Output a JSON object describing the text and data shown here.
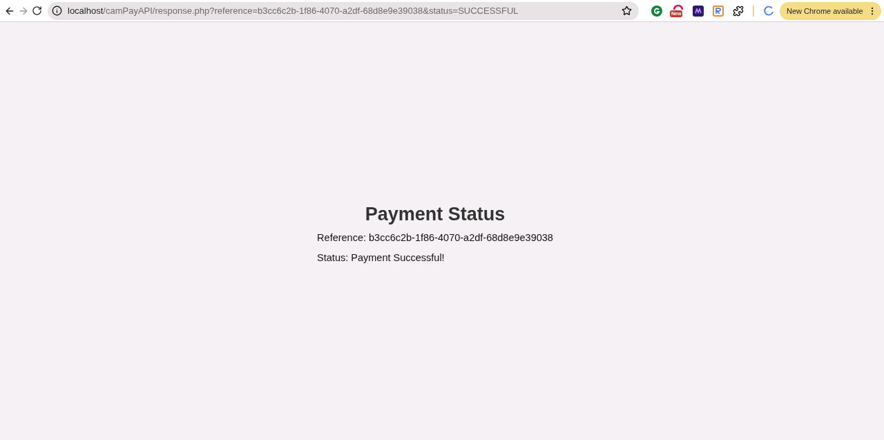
{
  "browser": {
    "url_host": "localhost",
    "url_path": "/camPayAPI/response.php?reference=b3cc6c2b-1f86-4070-a2df-68d8e9e39038&status=SUCCESSFUL",
    "extension_badge": "New",
    "update_button": "New Chrome available",
    "forward_disabled": true
  },
  "page": {
    "title": "Payment Status",
    "lines": [
      "Reference: b3cc6c2b-1f86-4070-a2df-68d8e9e39038",
      "Status: Payment Successful!"
    ]
  }
}
